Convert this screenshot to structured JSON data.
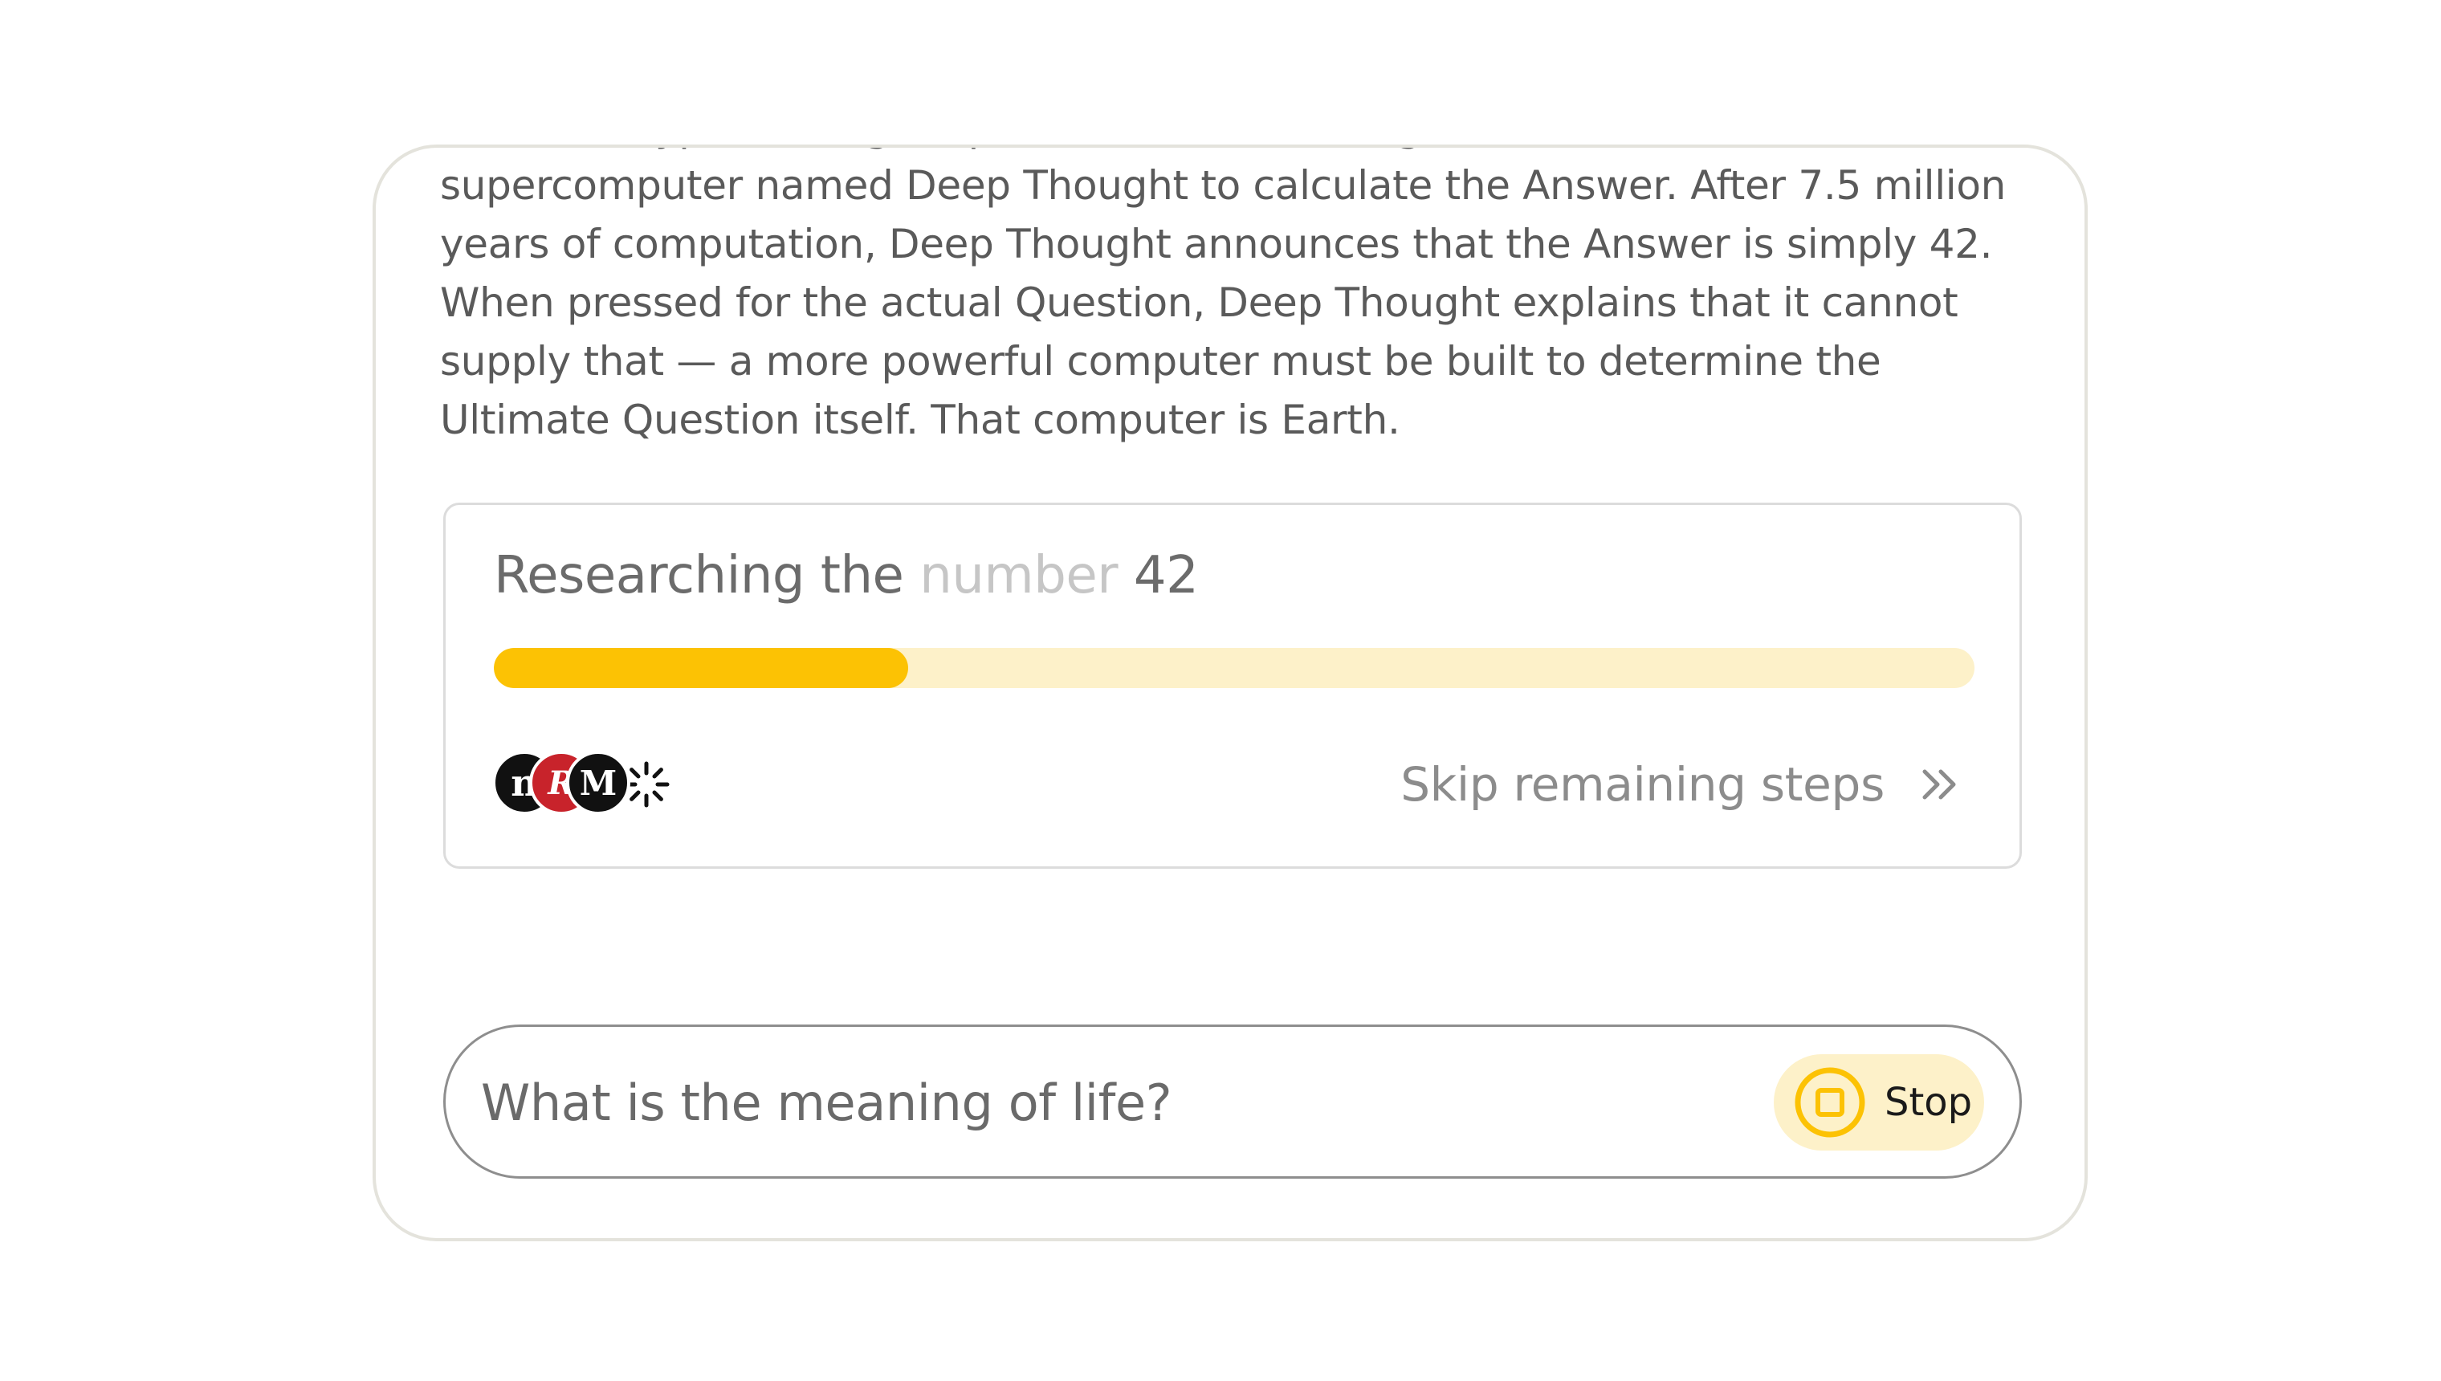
{
  "answer": {
    "text": "A race of hyper-intelligent pan-dimensional beings builds a vast\nsupercomputer named Deep Thought to calculate the Answer. After 7.5 million\nyears of computation, Deep Thought announces that the Answer is simply 42.\nWhen pressed for the actual Question, Deep Thought explains that it cannot\nsupply that — a more powerful computer must be built to determine the\nUltimate Question itself. That computer is Earth."
  },
  "research": {
    "title_start": "Researching the ",
    "title_shimmer": "number",
    "title_end": " 42",
    "progress_fraction": 0.28,
    "sources": [
      {
        "letter": "n",
        "icon": "source-logo-n",
        "color": "#111111"
      },
      {
        "letter": "R",
        "icon": "source-logo-r",
        "color": "#c8232b"
      },
      {
        "letter": "M",
        "icon": "source-logo-m",
        "color": "#111111"
      }
    ],
    "loading_icon": "spinner-icon",
    "skip_label": "Skip remaining steps",
    "skip_icon": "double-chevron-right-icon"
  },
  "composer": {
    "query_value": "What is the meaning of life?",
    "stop_label": "Stop",
    "stop_icon": "stop-square-icon"
  },
  "colors": {
    "accent": "#fcc204",
    "accent_light": "#fdf1c9",
    "panel_border": "#e4e3dc",
    "text": "#5a5a5a"
  }
}
